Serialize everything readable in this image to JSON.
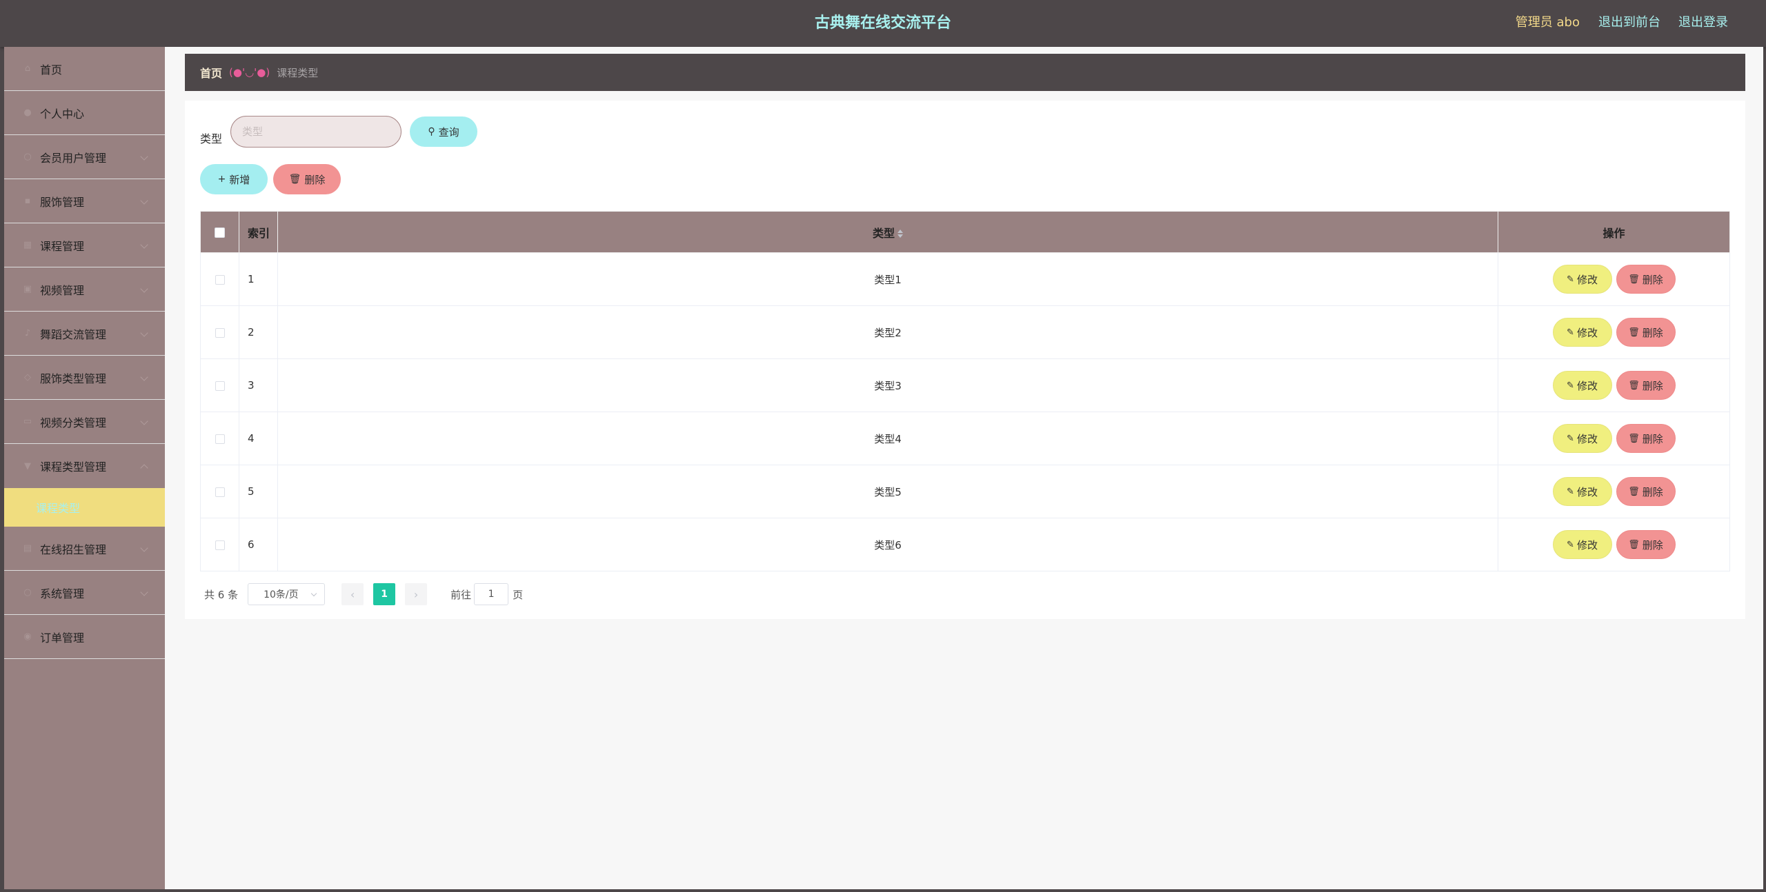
{
  "header": {
    "title": "古典舞在线交流平台",
    "admin_label": "管理员 abo",
    "front_link": "退出到前台",
    "logout_link": "退出登录"
  },
  "sidebar": {
    "items": [
      {
        "label": "首页",
        "icon": "home-icon"
      },
      {
        "label": "个人中心",
        "icon": "user-icon"
      },
      {
        "label": "会员用户管理",
        "icon": "users-icon"
      },
      {
        "label": "服饰管理",
        "icon": "shirt-icon"
      },
      {
        "label": "课程管理",
        "icon": "book-icon"
      },
      {
        "label": "视频管理",
        "icon": "video-icon"
      },
      {
        "label": "舞蹈交流管理",
        "icon": "chat-icon"
      },
      {
        "label": "服饰类型管理",
        "icon": "tag-icon"
      },
      {
        "label": "视频分类管理",
        "icon": "folder-icon"
      },
      {
        "label": "课程类型管理",
        "icon": "list-icon"
      },
      {
        "label": "在线招生管理",
        "icon": "lock-icon"
      },
      {
        "label": "系统管理",
        "icon": "gear-icon"
      },
      {
        "label": "订单管理",
        "icon": "order-icon"
      }
    ],
    "active_sub": "课程类型"
  },
  "breadcrumb": {
    "home": "首页",
    "separator": "(●'◡'●)",
    "current": "课程类型"
  },
  "search": {
    "label": "类型",
    "placeholder": "类型",
    "query_button": "查询"
  },
  "toolbar": {
    "add_button": "新增",
    "delete_button": "删除"
  },
  "table": {
    "headers": {
      "index": "索引",
      "type": "类型",
      "ops": "操作"
    },
    "rows": [
      {
        "index": "1",
        "type": "类型1"
      },
      {
        "index": "2",
        "type": "类型2"
      },
      {
        "index": "3",
        "type": "类型3"
      },
      {
        "index": "4",
        "type": "类型4"
      },
      {
        "index": "5",
        "type": "类型5"
      },
      {
        "index": "6",
        "type": "类型6"
      }
    ],
    "edit_label": "修改",
    "delete_label": "删除"
  },
  "pagination": {
    "total": "共 6 条",
    "page_size": "10条/页",
    "current_page": "1",
    "goto_label": "前往",
    "goto_value": "1",
    "page_suffix": "页"
  },
  "colors": {
    "header_bg": "#4d4749",
    "sidebar_bg": "#988181",
    "accent_cyan": "#a4eef0",
    "danger_pink": "#f29393",
    "edit_yellow": "#f0ef7f",
    "active_yellow": "#f0dd7f",
    "page_green": "#1ec6a2"
  }
}
